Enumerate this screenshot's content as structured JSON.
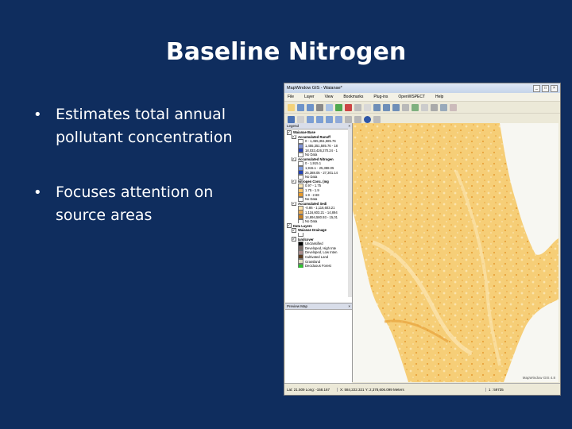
{
  "slide": {
    "title": "Baseline Nitrogen",
    "bullets": [
      {
        "line1": "Estimates total annual",
        "line2": "pollutant concentration"
      },
      {
        "line1": "Focuses attention on",
        "line2": "source areas"
      }
    ]
  },
  "app": {
    "window_title": "MapWindow GIS - Waianae*",
    "menu": [
      "File",
      "Layer",
      "View",
      "Bookmarks",
      "Plug-ins",
      "OpenWSPECT",
      "Help"
    ],
    "panels": {
      "legend": "Legend",
      "preview": "Preview Map"
    },
    "legend_items": [
      {
        "type": "group",
        "label": "Waianae Base"
      },
      {
        "type": "layer",
        "label": "Accumulated Runoff"
      },
      {
        "type": "class",
        "label": "0 - 1,455,351,585.76",
        "color": "#ffffff"
      },
      {
        "type": "class",
        "label": "1,455,351,585.76 - 18",
        "color": "#7f94d8"
      },
      {
        "type": "class",
        "label": "18,033,426,270.24 - 1",
        "color": "#2b45b5"
      },
      {
        "type": "class",
        "label": "No Data",
        "color": "#ffffff"
      },
      {
        "type": "layer",
        "label": "Accumulated Nitrogen"
      },
      {
        "type": "class",
        "label": "0 - 1,915.1",
        "color": "#ffffff"
      },
      {
        "type": "class",
        "label": "1,915.1 - 25,388.05",
        "color": "#7e9be0"
      },
      {
        "type": "class",
        "label": "25,388.05 - 27,301.14",
        "color": "#2545b8"
      },
      {
        "type": "class",
        "label": "No Data",
        "color": "#ffffff"
      },
      {
        "type": "layer",
        "label": "Nitrogen Conc. (mg"
      },
      {
        "type": "class",
        "label": "0.97 - 1.75",
        "color": "#fbe6b4"
      },
      {
        "type": "class",
        "label": "1.75 - 1.9",
        "color": "#f7c56c"
      },
      {
        "type": "class",
        "label": "1.9 - 2.68",
        "color": "#e89a2b"
      },
      {
        "type": "class",
        "label": "No Data",
        "color": "#ffffff"
      },
      {
        "type": "layer",
        "label": "Accumulated Sedi"
      },
      {
        "type": "class",
        "label": "-0.86 - 1,116,603.21",
        "color": "#fce3b0"
      },
      {
        "type": "class",
        "label": "1,116,603.21 - 14,894",
        "color": "#e7a84e"
      },
      {
        "type": "class",
        "label": "14,894,580.93 - 15,01",
        "color": "#c97f1f"
      },
      {
        "type": "class",
        "label": "No Data",
        "color": "#ffffff"
      },
      {
        "type": "group",
        "label": "Data Layers"
      },
      {
        "type": "layer",
        "label": "Waianae Drainage"
      },
      {
        "type": "class",
        "label": "",
        "color": "#ffffff"
      },
      {
        "type": "layer",
        "label": "landcover"
      },
      {
        "type": "class",
        "label": "Unclassified",
        "color": "#000000"
      },
      {
        "type": "class",
        "label": "Developed, High Inte",
        "color": "#7a6b66"
      },
      {
        "type": "class",
        "label": "Developed, Low Inten",
        "color": "#a88c8c"
      },
      {
        "type": "class",
        "label": "Cultivated Land",
        "color": "#5a3b1e"
      },
      {
        "type": "class",
        "label": "Grassland",
        "color": "#e0dcc0"
      },
      {
        "type": "class",
        "label": "Deciduous Forest",
        "color": "#2fc42f"
      }
    ],
    "map_watermark": "MapWindow GIS 4.8",
    "status": {
      "latlong": "Lat: 21.509 Long: -158.167",
      "xy": "X: 584,222.321 Y: 2,378,606.099 Meters",
      "scale": "1 : 59735"
    },
    "colors": {
      "ocean": "#f7f7f2",
      "land": "#f6ce77",
      "land_light": "#fbe4ac",
      "land_dark": "#e8a33b"
    }
  }
}
